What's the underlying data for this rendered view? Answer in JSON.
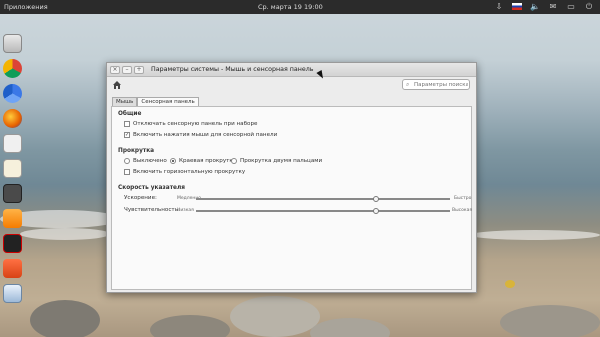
{
  "top_panel": {
    "apps_label": "Приложения",
    "clock": "Ср. марта 19 19:00",
    "tray_icons": [
      "download-icon",
      "flag-ru-icon",
      "volume-icon",
      "mail-icon",
      "battery-icon",
      "power-icon"
    ]
  },
  "dock": {
    "items": [
      "home-folder-icon",
      "chrome-icon",
      "chromium-icon",
      "firefox-icon",
      "text-editor-icon",
      "mail-app-icon",
      "terminal-icon",
      "music-icon",
      "video-icon",
      "photos-icon",
      "workspace-icon"
    ]
  },
  "window": {
    "title": "Параметры системы - Мышь и сенсорная панель",
    "search_placeholder": "Параметры поиска",
    "tabs": [
      "Мышь",
      "Сенсорная панель"
    ],
    "active_tab": "Сенсорная панель",
    "general": {
      "title": "Общие",
      "disable_while_typing": "Отключать сенсорную панель при наборе",
      "disable_while_typing_checked": false,
      "tap_to_click": "Включить нажатия мыши для сенсорной панели",
      "tap_to_click_checked": true
    },
    "scrolling": {
      "title": "Прокрутка",
      "options": [
        "Выключено",
        "Краевая прокрутка",
        "Прокрутка двумя пальцами"
      ],
      "selected": "Краевая прокрутка",
      "horizontal": "Включить горизонтальную прокрутку",
      "horizontal_checked": false
    },
    "pointer_speed": {
      "title": "Скорость указателя",
      "acceleration_label": "Ускорение:",
      "acceleration_min": "Медленно",
      "acceleration_max": "Быстро",
      "acceleration_value": 0.71,
      "sensitivity_label": "Чувствительность:",
      "sensitivity_min": "Низкая",
      "sensitivity_max": "Высокая",
      "sensitivity_value": 0.71
    }
  }
}
